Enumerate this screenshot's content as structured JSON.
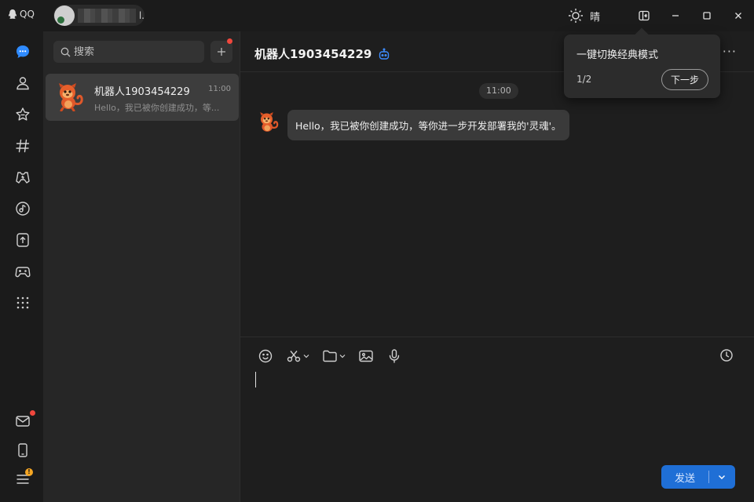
{
  "app": {
    "brand": "QQ"
  },
  "titlebar": {
    "user_name_suffix": "l.",
    "weather_label": "晴"
  },
  "rail": {
    "items": [
      "message-icon",
      "contacts-icon",
      "favorites-icon",
      "channel-icon",
      "games-center-icon",
      "music-icon",
      "upload-icon",
      "gamepad-icon",
      "apps-grid-icon",
      "mail-icon",
      "phone-icon",
      "menu-icon"
    ],
    "warn_badge": "!"
  },
  "search": {
    "placeholder": "搜索"
  },
  "conversations": [
    {
      "name": "机器人1903454229",
      "time": "11:00",
      "preview": "Hello，我已被你创建成功，等..."
    }
  ],
  "chat": {
    "title": "机器人1903454229",
    "more": "···",
    "time_divider": "11:00",
    "messages": [
      {
        "text": "Hello，我已被你创建成功，等你进一步开发部署我的'灵魂'。"
      }
    ]
  },
  "composer": {
    "send_label": "发送"
  },
  "guide": {
    "title": "一键切换经典模式",
    "step": "1/2",
    "next_label": "下一步"
  },
  "colors": {
    "accent": "#1f6fd6",
    "badge_red": "#f0473d",
    "badge_orange": "#f5a623",
    "bot_blue": "#3d8bfd"
  }
}
